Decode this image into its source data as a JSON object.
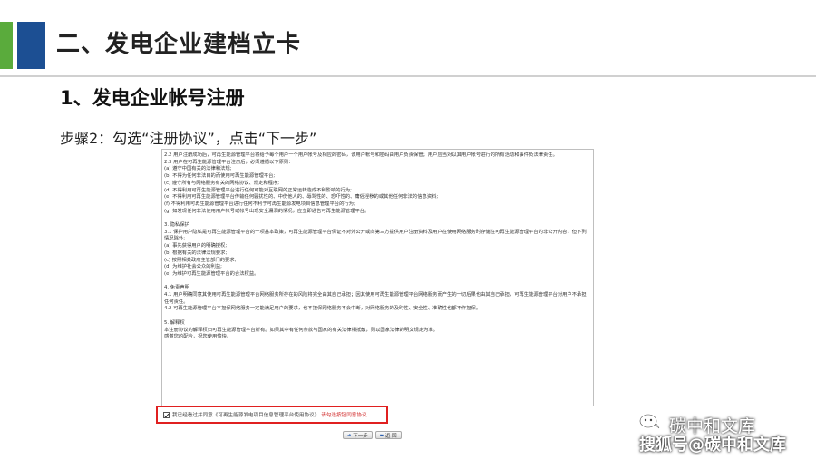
{
  "slide": {
    "title": "二、发电企业建档立卡",
    "subtitle": "1、发电企业帐号注册",
    "step": "步骤2：勾选“注册协议”，点击“下一步”"
  },
  "agreement": {
    "lines": [
      {
        "t": "2.2 用户注册成功后，可再生能源管理平台将给予每个用户一个用户帐号及相应的密码，该用户帐号和密码由用户负责保管；用户应当对以其用户帐号进行的所有活动和事件负法律责任。",
        "w": true
      },
      {
        "t": "2.3 用户在可再生能源管理平台注册后，必须遵循以下原则："
      },
      {
        "t": "(a) 遵守中国有关的法律和法规;"
      },
      {
        "t": "(b) 不得为任何非法目的而使用可再生能源管理平台;"
      },
      {
        "t": "(c) 遵守所有与网络服务有关的网络协议、规定和程序;"
      },
      {
        "t": "(d) 不得利用可再生能源管理平台进行任何可能对互联网的正常运转造成不利影响的行为;"
      },
      {
        "t": "(e) 不得利用可再生能源管理平台传输任何骚扰性的、中伤他人的、辱骂性的、恐吓性的、庸俗淫秽的或其他任何非法的信息资料;"
      },
      {
        "t": "(f) 不得利用可再生能源管理平台进行任何不利于可再生能源发电项目信息管理平台的行为;"
      },
      {
        "t": "(g) 如发现任何非法使用用户帐号或帐号出现安全漏洞的情况，应立即通告可再生能源管理平台。"
      },
      {
        "t": "",
        "gap": true
      },
      {
        "t": "3. 隐私保护"
      },
      {
        "t": "3.1 保护用户隐私是可再生能源管理平台的一项基本政策，可再生能源管理平台保证不对外公开或向第三方提供用户注册资料及用户在使用网络服务时存储在可再生能源管理平台的非公开内容，但下列情况除外:",
        "w": true
      },
      {
        "t": "(a) 事先获得用户的明确授权;"
      },
      {
        "t": "(b) 根据有关的法律法规要求;"
      },
      {
        "t": "(c) 按照相关政府主管部门的要求;"
      },
      {
        "t": "(d) 为维护社会公众的利益;"
      },
      {
        "t": "(e) 为维护可再生能源管理平台的合法权益。"
      },
      {
        "t": "",
        "gap": true
      },
      {
        "t": "4. 免责声明"
      },
      {
        "t": "4.1 用户明确同意其使用可再生能源管理平台网络服务所存在的风险将完全由其自己承担；因其使用可再生能源管理平台网络服务而产生的一切后果也由其自己承担，可再生能源管理平台对用户不承担任何责任。",
        "w": true
      },
      {
        "t": "4.2 可再生能源管理平台不担保网络服务一定能满足用户的要求，也不担保网络服务不会中断，对网络服务的及时性、安全性、准确性也都不作担保。"
      },
      {
        "t": "",
        "gap": true
      },
      {
        "t": "5. 解释权"
      },
      {
        "t": "本注册协议的解释权归可再生能源管理平台所有。如果其中有任何条款与国家的有关法律相抵触，则以国家法律的明文规定为准。"
      },
      {
        "t": "感谢您的配合，祝您使用愉快。"
      }
    ]
  },
  "consent": {
    "label": "我已经看过并同意《可再生能源发电项目信息管理平台使用协议》",
    "warning": "请勾选按钮同意协议"
  },
  "buttons": {
    "next": "下一步",
    "back": "返 回"
  },
  "watermark": {
    "name": "碳中和文库",
    "sohu": "搜狐号@碳中和文库"
  },
  "colors": {
    "accent_blue": "#1c4f93",
    "accent_green": "#5aab3c",
    "highlight_red": "#e02020"
  }
}
